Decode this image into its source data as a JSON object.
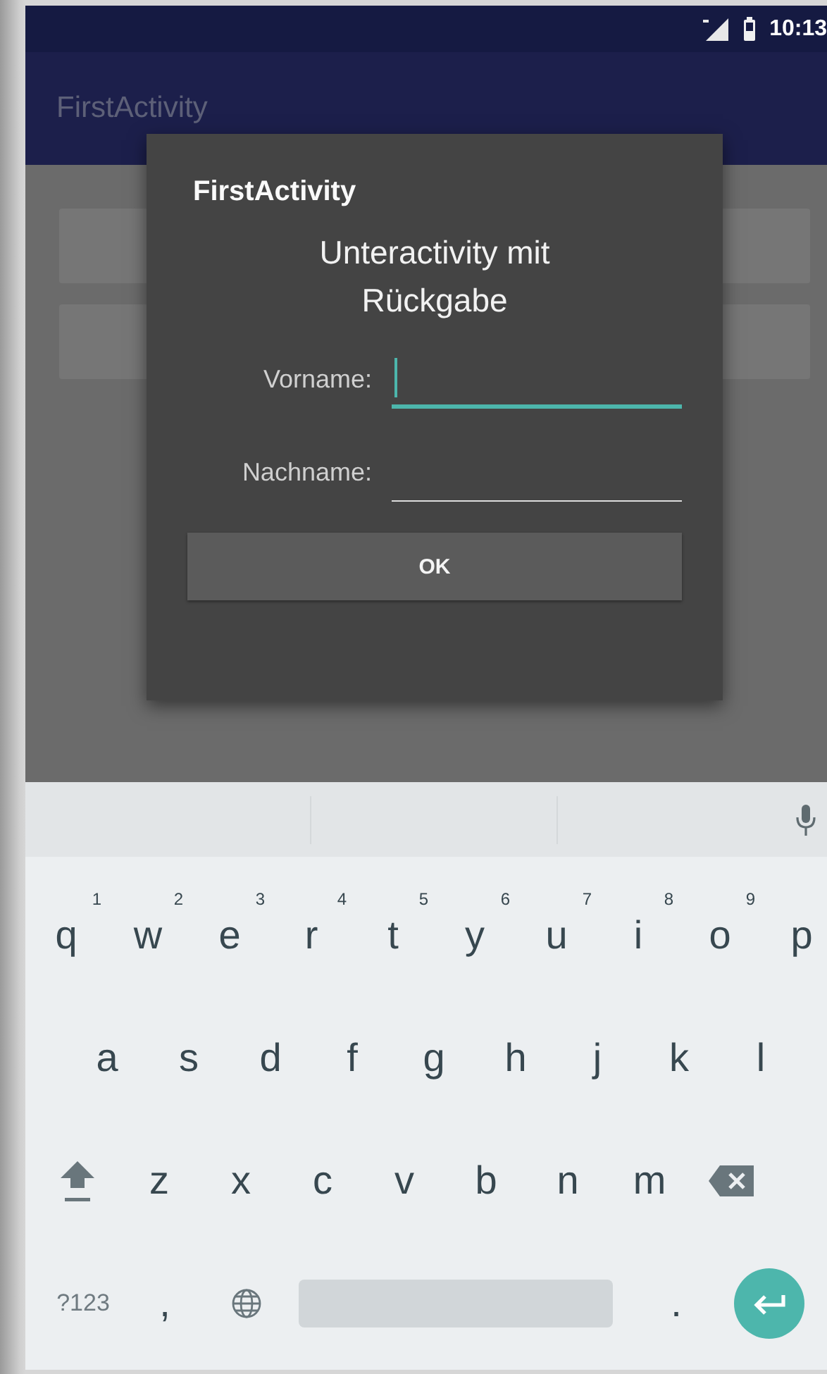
{
  "status_bar": {
    "time": "10:13"
  },
  "app_bar": {
    "title": "FirstActivity"
  },
  "background_buttons": [
    {
      "kind": "button"
    },
    {
      "kind": "button"
    }
  ],
  "dialog": {
    "title": "FirstActivity",
    "message": "Unteractivity mit Rückgabe",
    "button": "OK",
    "fields": [
      {
        "label": "Vorname:",
        "focused": true
      },
      {
        "label": "Nachname:",
        "focused": false
      }
    ]
  },
  "keyboard": {
    "rows": [
      [
        {
          "kind": "letter",
          "key": "q",
          "hint": "1"
        },
        {
          "kind": "letter",
          "key": "w",
          "hint": "2"
        },
        {
          "kind": "letter",
          "key": "e",
          "hint": "3"
        },
        {
          "kind": "letter",
          "key": "r",
          "hint": "4"
        },
        {
          "kind": "letter",
          "key": "t",
          "hint": "5"
        },
        {
          "kind": "letter",
          "key": "y",
          "hint": "6"
        },
        {
          "kind": "letter",
          "key": "u",
          "hint": "7"
        },
        {
          "kind": "letter",
          "key": "i",
          "hint": "8"
        },
        {
          "kind": "letter",
          "key": "o",
          "hint": "9"
        },
        {
          "kind": "letter",
          "key": "p"
        }
      ],
      [
        {
          "kind": "letter",
          "key": "a"
        },
        {
          "kind": "letter",
          "key": "s"
        },
        {
          "kind": "letter",
          "key": "d"
        },
        {
          "kind": "letter",
          "key": "f"
        },
        {
          "kind": "letter",
          "key": "g"
        },
        {
          "kind": "letter",
          "key": "h"
        },
        {
          "kind": "letter",
          "key": "j"
        },
        {
          "kind": "letter",
          "key": "k"
        },
        {
          "kind": "letter",
          "key": "l"
        }
      ],
      [
        {
          "kind": "shift"
        },
        {
          "kind": "letter",
          "key": "z"
        },
        {
          "kind": "letter",
          "key": "x"
        },
        {
          "kind": "letter",
          "key": "c"
        },
        {
          "kind": "letter",
          "key": "v"
        },
        {
          "kind": "letter",
          "key": "b"
        },
        {
          "kind": "letter",
          "key": "n"
        },
        {
          "kind": "letter",
          "key": "m"
        },
        {
          "kind": "backspace"
        }
      ],
      [
        {
          "kind": "symbols",
          "key": "?123"
        },
        {
          "kind": "letter",
          "key": ","
        },
        {
          "kind": "globe"
        },
        {
          "kind": "space"
        },
        {
          "kind": "letter",
          "key": "."
        },
        {
          "kind": "enter"
        }
      ]
    ]
  }
}
